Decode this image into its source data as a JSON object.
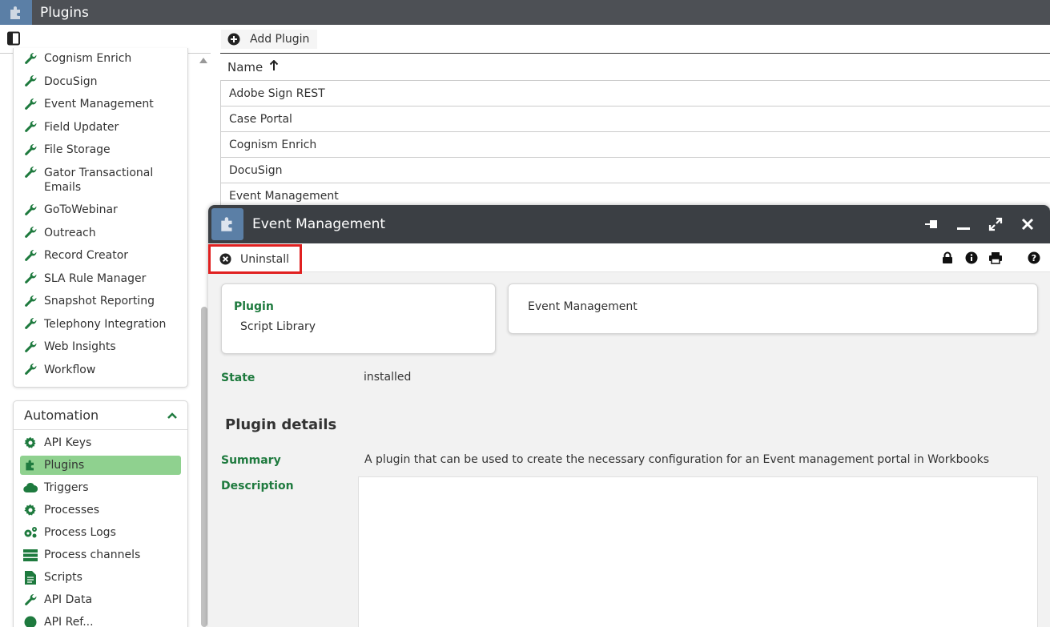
{
  "app": {
    "title": "Plugins",
    "icon": "puzzle-icon"
  },
  "sidebar": {
    "plugin_items": [
      {
        "label": "Cognism Enrich",
        "icon": "wrench-icon"
      },
      {
        "label": "DocuSign",
        "icon": "wrench-icon"
      },
      {
        "label": "Event Management",
        "icon": "wrench-icon"
      },
      {
        "label": "Field Updater",
        "icon": "wrench-icon"
      },
      {
        "label": "File Storage",
        "icon": "wrench-icon"
      },
      {
        "label": "Gator Transactional Emails",
        "icon": "wrench-icon"
      },
      {
        "label": "GoToWebinar",
        "icon": "wrench-icon"
      },
      {
        "label": "Outreach",
        "icon": "wrench-icon"
      },
      {
        "label": "Record Creator",
        "icon": "wrench-icon"
      },
      {
        "label": "SLA Rule Manager",
        "icon": "wrench-icon"
      },
      {
        "label": "Snapshot Reporting",
        "icon": "wrench-icon"
      },
      {
        "label": "Telephony Integration",
        "icon": "wrench-icon"
      },
      {
        "label": "Web Insights",
        "icon": "wrench-icon"
      },
      {
        "label": "Workflow",
        "icon": "wrench-icon"
      }
    ],
    "automation": {
      "title": "Automation",
      "items": [
        {
          "label": "API Keys",
          "icon": "gear-icon"
        },
        {
          "label": "Plugins",
          "icon": "puzzle-icon",
          "active": true
        },
        {
          "label": "Triggers",
          "icon": "cloud-icon"
        },
        {
          "label": "Processes",
          "icon": "gear-icon"
        },
        {
          "label": "Process Logs",
          "icon": "gears-icon"
        },
        {
          "label": "Process channels",
          "icon": "server-icon"
        },
        {
          "label": "Scripts",
          "icon": "file-icon"
        },
        {
          "label": "API Data",
          "icon": "wrench-icon"
        },
        {
          "label": "API Ref...",
          "icon": "globe-icon"
        }
      ]
    }
  },
  "main": {
    "add_button": "Add Plugin",
    "list_header": "Name",
    "rows": [
      "Adobe Sign REST",
      "Case Portal",
      "Cognism Enrich",
      "DocuSign",
      "Event Management"
    ]
  },
  "window": {
    "title": "Event Management",
    "uninstall": "Uninstall",
    "card_plugin_label": "Plugin",
    "card_plugin_value": "Script Library",
    "card_name_value": "Event Management",
    "state_label": "State",
    "state_value": "installed",
    "section_title": "Plugin details",
    "summary_label": "Summary",
    "summary_value": "A plugin that can be used to create the necessary configuration for an Event management portal in Workbooks",
    "description_label": "Description",
    "description_value": ""
  },
  "colors": {
    "accent_green": "#1e7a3e",
    "active_bg": "#8fd18f",
    "highlight_red": "#e02020",
    "titlebar": "#3b3f44"
  }
}
